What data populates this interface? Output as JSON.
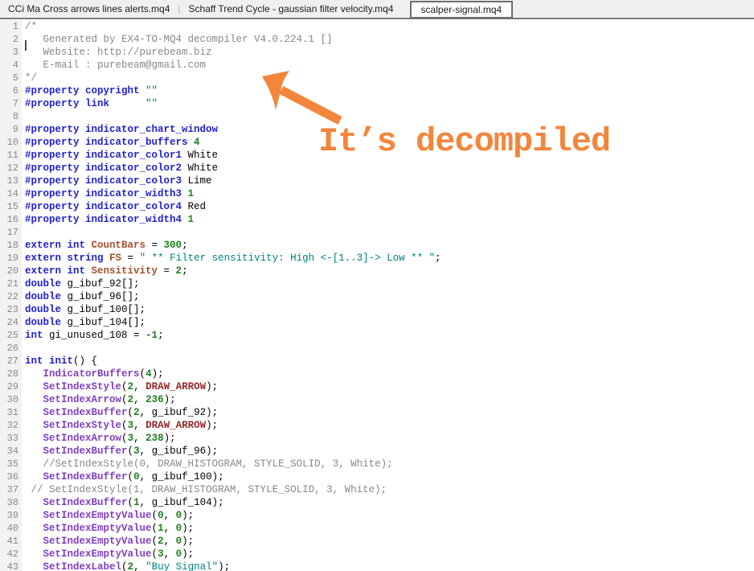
{
  "tabs": {
    "separator": "|",
    "items": [
      {
        "label": "CCi Ma Cross arrows lines alerts.mq4",
        "active": false
      },
      {
        "label": "Schaff Trend Cycle - gaussian filter velocity.mq4",
        "active": false
      },
      {
        "label": "scalper-signal.mq4",
        "active": true
      }
    ]
  },
  "annotation": {
    "text": "It’s decompiled",
    "arrow_icon": "arrow-pointing-up-left",
    "color": "#F2863B"
  },
  "editor": {
    "language": "mql4",
    "caret": {
      "line": 1,
      "column": 1
    },
    "colors": {
      "keyword": "#2222CC",
      "function": "#8040C0",
      "number": "#208020",
      "string": "#008080",
      "comment": "#878787",
      "constant": "#942A2A",
      "variable": "#A2522E",
      "plain": "#000000"
    },
    "lines": [
      [
        [
          "c",
          "/*"
        ]
      ],
      [
        [
          "c",
          "   Generated by EX4-TO-MQ4 decompiler V4.0.224.1 []"
        ]
      ],
      [
        [
          "c",
          "   Website: http://purebeam.biz"
        ]
      ],
      [
        [
          "c",
          "   E-mail : purebeam@gmail.com"
        ]
      ],
      [
        [
          "c",
          "*/"
        ]
      ],
      [
        [
          "k",
          "#property copyright "
        ],
        [
          "s",
          "\"\""
        ]
      ],
      [
        [
          "k",
          "#property link      "
        ],
        [
          "s",
          "\"\""
        ]
      ],
      [],
      [
        [
          "k",
          "#property indicator_chart_window"
        ]
      ],
      [
        [
          "k",
          "#property indicator_buffers "
        ],
        [
          "n",
          "4"
        ]
      ],
      [
        [
          "k",
          "#property indicator_color1 "
        ],
        [
          "p",
          "White"
        ]
      ],
      [
        [
          "k",
          "#property indicator_color2 "
        ],
        [
          "p",
          "White"
        ]
      ],
      [
        [
          "k",
          "#property indicator_color3 "
        ],
        [
          "p",
          "Lime"
        ]
      ],
      [
        [
          "k",
          "#property indicator_width3 "
        ],
        [
          "n",
          "1"
        ]
      ],
      [
        [
          "k",
          "#property indicator_color4 "
        ],
        [
          "p",
          "Red"
        ]
      ],
      [
        [
          "k",
          "#property indicator_width4 "
        ],
        [
          "n",
          "1"
        ]
      ],
      [],
      [
        [
          "k",
          "extern int "
        ],
        [
          "v",
          "CountBars"
        ],
        [
          "p",
          " = "
        ],
        [
          "n",
          "300"
        ],
        [
          "p",
          ";"
        ]
      ],
      [
        [
          "k",
          "extern string "
        ],
        [
          "v",
          "FS"
        ],
        [
          "p",
          " = "
        ],
        [
          "s",
          "\" ** Filter sensitivity: High <-[1..3]-> Low ** \""
        ],
        [
          "p",
          ";"
        ]
      ],
      [
        [
          "k",
          "extern int "
        ],
        [
          "v",
          "Sensitivity"
        ],
        [
          "p",
          " = "
        ],
        [
          "n",
          "2"
        ],
        [
          "p",
          ";"
        ]
      ],
      [
        [
          "k",
          "double "
        ],
        [
          "p",
          "g_ibuf_92[];"
        ]
      ],
      [
        [
          "k",
          "double "
        ],
        [
          "p",
          "g_ibuf_96[];"
        ]
      ],
      [
        [
          "k",
          "double "
        ],
        [
          "p",
          "g_ibuf_100[];"
        ]
      ],
      [
        [
          "k",
          "double "
        ],
        [
          "p",
          "g_ibuf_104[];"
        ]
      ],
      [
        [
          "k",
          "int "
        ],
        [
          "p",
          "gi_unused_108 = -"
        ],
        [
          "n",
          "1"
        ],
        [
          "p",
          ";"
        ]
      ],
      [],
      [
        [
          "k",
          "int init"
        ],
        [
          "p",
          "() {"
        ]
      ],
      [
        [
          "p",
          "   "
        ],
        [
          "f",
          "IndicatorBuffers"
        ],
        [
          "p",
          "("
        ],
        [
          "n",
          "4"
        ],
        [
          "p",
          ");"
        ]
      ],
      [
        [
          "p",
          "   "
        ],
        [
          "f",
          "SetIndexStyle"
        ],
        [
          "p",
          "("
        ],
        [
          "n",
          "2"
        ],
        [
          "p",
          ", "
        ],
        [
          "d",
          "DRAW_ARROW"
        ],
        [
          "p",
          ");"
        ]
      ],
      [
        [
          "p",
          "   "
        ],
        [
          "f",
          "SetIndexArrow"
        ],
        [
          "p",
          "("
        ],
        [
          "n",
          "2"
        ],
        [
          "p",
          ", "
        ],
        [
          "n",
          "236"
        ],
        [
          "p",
          ");"
        ]
      ],
      [
        [
          "p",
          "   "
        ],
        [
          "f",
          "SetIndexBuffer"
        ],
        [
          "p",
          "("
        ],
        [
          "n",
          "2"
        ],
        [
          "p",
          ", g_ibuf_92);"
        ]
      ],
      [
        [
          "p",
          "   "
        ],
        [
          "f",
          "SetIndexStyle"
        ],
        [
          "p",
          "("
        ],
        [
          "n",
          "3"
        ],
        [
          "p",
          ", "
        ],
        [
          "d",
          "DRAW_ARROW"
        ],
        [
          "p",
          ");"
        ]
      ],
      [
        [
          "p",
          "   "
        ],
        [
          "f",
          "SetIndexArrow"
        ],
        [
          "p",
          "("
        ],
        [
          "n",
          "3"
        ],
        [
          "p",
          ", "
        ],
        [
          "n",
          "238"
        ],
        [
          "p",
          ");"
        ]
      ],
      [
        [
          "p",
          "   "
        ],
        [
          "f",
          "SetIndexBuffer"
        ],
        [
          "p",
          "("
        ],
        [
          "n",
          "3"
        ],
        [
          "p",
          ", g_ibuf_96);"
        ]
      ],
      [
        [
          "p",
          "   "
        ],
        [
          "c",
          "//SetIndexStyle(0, DRAW_HISTOGRAM, STYLE_SOLID, 3, White);"
        ]
      ],
      [
        [
          "p",
          "   "
        ],
        [
          "f",
          "SetIndexBuffer"
        ],
        [
          "p",
          "("
        ],
        [
          "n",
          "0"
        ],
        [
          "p",
          ", g_ibuf_100);"
        ]
      ],
      [
        [
          "p",
          " "
        ],
        [
          "c",
          "// SetIndexStyle(1, DRAW_HISTOGRAM, STYLE_SOLID, 3, White);"
        ]
      ],
      [
        [
          "p",
          "   "
        ],
        [
          "f",
          "SetIndexBuffer"
        ],
        [
          "p",
          "("
        ],
        [
          "n",
          "1"
        ],
        [
          "p",
          ", g_ibuf_104);"
        ]
      ],
      [
        [
          "p",
          "   "
        ],
        [
          "f",
          "SetIndexEmptyValue"
        ],
        [
          "p",
          "("
        ],
        [
          "n",
          "0"
        ],
        [
          "p",
          ", "
        ],
        [
          "n",
          "0"
        ],
        [
          "p",
          ");"
        ]
      ],
      [
        [
          "p",
          "   "
        ],
        [
          "f",
          "SetIndexEmptyValue"
        ],
        [
          "p",
          "("
        ],
        [
          "n",
          "1"
        ],
        [
          "p",
          ", "
        ],
        [
          "n",
          "0"
        ],
        [
          "p",
          ");"
        ]
      ],
      [
        [
          "p",
          "   "
        ],
        [
          "f",
          "SetIndexEmptyValue"
        ],
        [
          "p",
          "("
        ],
        [
          "n",
          "2"
        ],
        [
          "p",
          ", "
        ],
        [
          "n",
          "0"
        ],
        [
          "p",
          ");"
        ]
      ],
      [
        [
          "p",
          "   "
        ],
        [
          "f",
          "SetIndexEmptyValue"
        ],
        [
          "p",
          "("
        ],
        [
          "n",
          "3"
        ],
        [
          "p",
          ", "
        ],
        [
          "n",
          "0"
        ],
        [
          "p",
          ");"
        ]
      ],
      [
        [
          "p",
          "   "
        ],
        [
          "f",
          "SetIndexLabel"
        ],
        [
          "p",
          "("
        ],
        [
          "n",
          "2"
        ],
        [
          "p",
          ", "
        ],
        [
          "s",
          "\"Buy Signal\""
        ],
        [
          "p",
          ");"
        ]
      ]
    ]
  }
}
